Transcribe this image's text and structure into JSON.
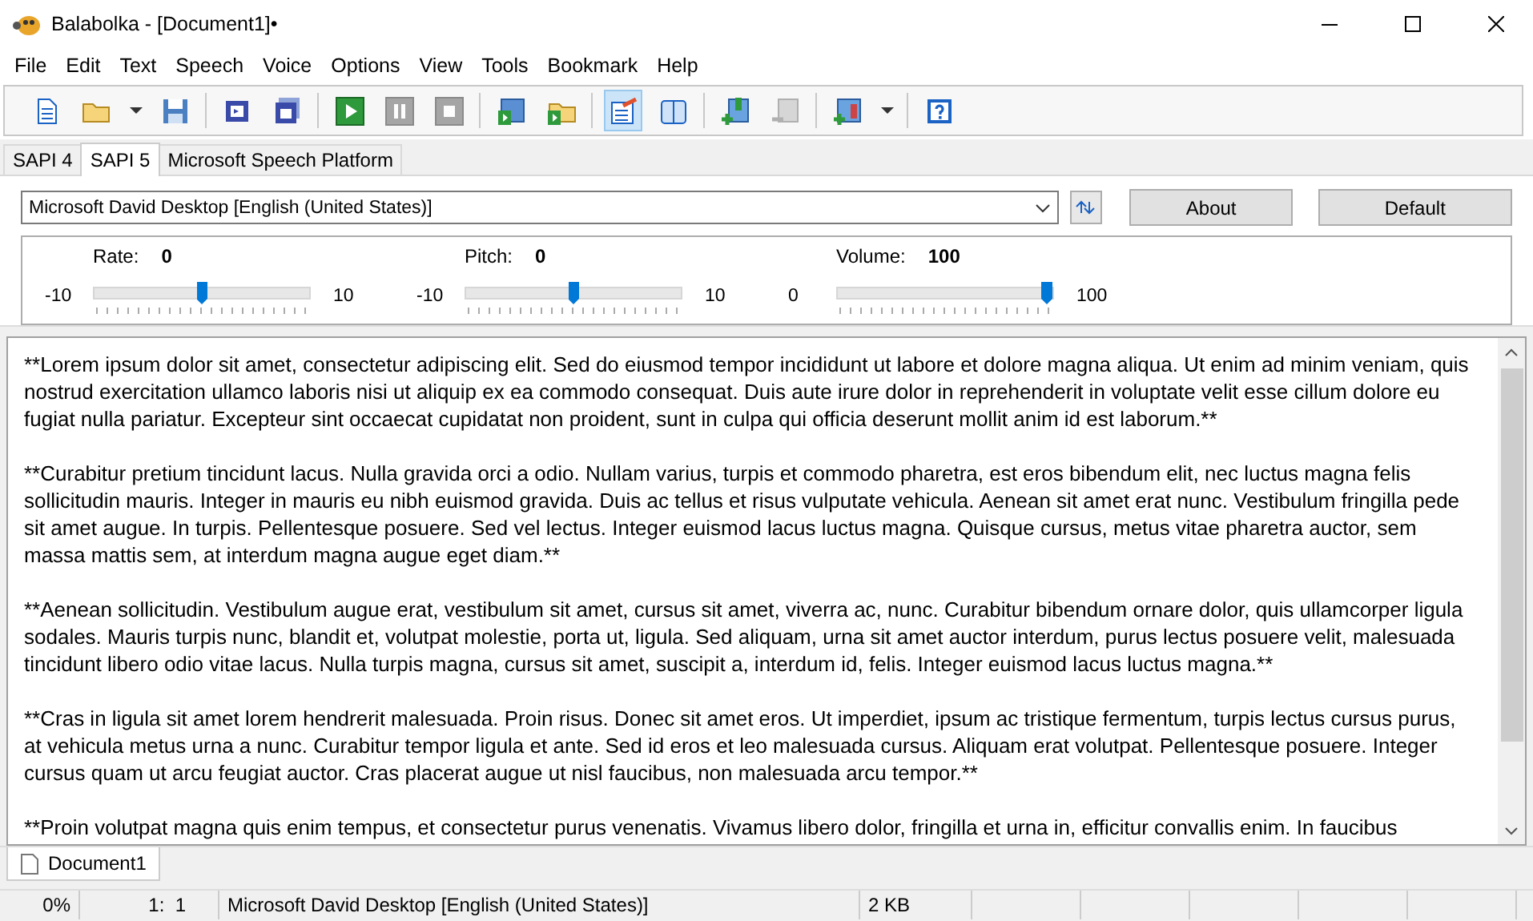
{
  "window": {
    "title": "Balabolka - [Document1]•"
  },
  "menu": [
    "File",
    "Edit",
    "Text",
    "Speech",
    "Voice",
    "Options",
    "View",
    "Tools",
    "Bookmark",
    "Help"
  ],
  "toolbar": [
    {
      "kind": "document",
      "pressed": false,
      "disabled": false
    },
    {
      "kind": "folder",
      "pressed": false,
      "disabled": false
    },
    {
      "kind": "caret",
      "pressed": false,
      "disabled": false
    },
    {
      "kind": "save",
      "pressed": false,
      "disabled": false
    },
    {
      "kind": "separator"
    },
    {
      "kind": "audio-file",
      "pressed": false,
      "disabled": false
    },
    {
      "kind": "audio-files",
      "pressed": false,
      "disabled": false
    },
    {
      "kind": "separator"
    },
    {
      "kind": "play",
      "pressed": false,
      "disabled": false
    },
    {
      "kind": "pause",
      "pressed": false,
      "disabled": true
    },
    {
      "kind": "stop",
      "pressed": false,
      "disabled": true
    },
    {
      "kind": "separator"
    },
    {
      "kind": "book-play",
      "pressed": false,
      "disabled": false
    },
    {
      "kind": "folder-play",
      "pressed": false,
      "disabled": false
    },
    {
      "kind": "separator"
    },
    {
      "kind": "edit",
      "pressed": true,
      "disabled": false
    },
    {
      "kind": "book",
      "pressed": false,
      "disabled": false
    },
    {
      "kind": "separator"
    },
    {
      "kind": "book-add",
      "pressed": false,
      "disabled": false
    },
    {
      "kind": "book-remove",
      "pressed": false,
      "disabled": true
    },
    {
      "kind": "separator"
    },
    {
      "kind": "book-list",
      "pressed": false,
      "disabled": false
    },
    {
      "kind": "caret",
      "pressed": false,
      "disabled": false
    },
    {
      "kind": "separator"
    },
    {
      "kind": "help",
      "pressed": false,
      "disabled": false
    }
  ],
  "engine_tabs": [
    {
      "label": "SAPI 4",
      "selected": false
    },
    {
      "label": "SAPI 5",
      "selected": true
    },
    {
      "label": "Microsoft Speech Platform",
      "selected": false
    }
  ],
  "voice": {
    "value": "Microsoft David Desktop [English (United States)]"
  },
  "buttons": [
    "About",
    "Default"
  ],
  "sliders": [
    {
      "label": "Rate:",
      "value": "0",
      "min": "-10",
      "max": "10",
      "level": 0.5
    },
    {
      "label": "Pitch:",
      "value": "0",
      "min": "-10",
      "max": "10",
      "level": 0.5
    },
    {
      "label": "Volume:",
      "value": "100",
      "min": "0",
      "max": "100",
      "level": 1
    }
  ],
  "paragraphs": [
    "**Lorem ipsum dolor sit amet, consectetur adipiscing elit. Sed do eiusmod tempor incididunt ut labore et dolore magna aliqua. Ut enim ad minim veniam, quis nostrud exercitation ullamco laboris nisi ut aliquip ex ea commodo consequat. Duis aute irure dolor in reprehenderit in voluptate velit esse cillum dolore eu fugiat nulla pariatur. Excepteur sint occaecat cupidatat non proident, sunt in culpa qui officia deserunt mollit anim id est laborum.**",
    "**Curabitur pretium tincidunt lacus. Nulla gravida orci a odio. Nullam varius, turpis et commodo pharetra, est eros bibendum elit, nec luctus magna felis sollicitudin mauris. Integer in mauris eu nibh euismod gravida. Duis ac tellus et risus vulputate vehicula. Aenean sit amet erat nunc. Vestibulum fringilla pede sit amet augue. In turpis. Pellentesque posuere. Sed vel lectus. Integer euismod lacus luctus magna. Quisque cursus, metus vitae pharetra auctor, sem massa mattis sem, at interdum magna augue eget diam.**",
    "**Aenean sollicitudin. Vestibulum augue erat, vestibulum sit amet, cursus sit amet, viverra ac, nunc. Curabitur bibendum ornare dolor, quis ullamcorper ligula sodales. Mauris turpis nunc, blandit et, volutpat molestie, porta ut, ligula. Sed aliquam, urna sit amet auctor interdum, purus lectus posuere velit, malesuada tincidunt libero odio vitae lacus. Nulla turpis magna, cursus sit amet, suscipit a, interdum id, felis. Integer euismod lacus luctus magna.**",
    "**Cras in ligula sit amet lorem hendrerit malesuada. Proin risus. Donec sit amet eros. Ut imperdiet, ipsum ac tristique fermentum, turpis lectus cursus purus, at vehicula metus urna a nunc. Curabitur tempor ligula et ante. Sed id eros et leo malesuada cursus. Aliquam erat volutpat. Pellentesque posuere. Integer cursus quam ut arcu feugiat auctor. Cras placerat augue ut nisl faucibus, non malesuada arcu tempor.**",
    "**Proin volutpat magna quis enim tempus, et consectetur purus venenatis. Vivamus libero dolor, fringilla et urna in, efficitur convallis enim. In faucibus"
  ],
  "document_tabs": [
    {
      "label": "Document1",
      "selected": true
    }
  ],
  "status_bar": [
    "0%",
    "1:  1",
    "Microsoft David Desktop [English (United States)]",
    "2 KB"
  ]
}
